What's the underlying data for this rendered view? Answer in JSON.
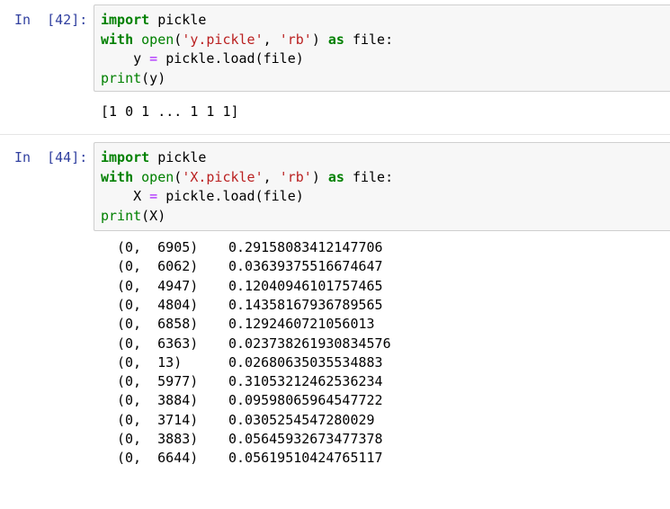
{
  "cells": [
    {
      "prompt": "In  [42]:",
      "code": {
        "line1": {
          "kw": "import",
          "rest": " pickle"
        },
        "line2": {
          "kw": "with",
          "sp1": " ",
          "fn": "open",
          "p1": "(",
          "s1": "'y.pickle'",
          "c": ", ",
          "s2": "'rb'",
          "p2": ") ",
          "kw2": "as",
          "rest": " file:"
        },
        "line3": {
          "indent": "    ",
          "var": "y",
          "eq": " = ",
          "rest": "pickle.load(file)"
        },
        "line4": {
          "fn": "print",
          "rest": "(y)"
        }
      },
      "output": "[1 0 1 ... 1 1 1]"
    },
    {
      "prompt": "In  [44]:",
      "code": {
        "line1": {
          "kw": "import",
          "rest": " pickle"
        },
        "line2": {
          "kw": "with",
          "sp1": " ",
          "fn": "open",
          "p1": "(",
          "s1": "'X.pickle'",
          "c": ", ",
          "s2": "'rb'",
          "p2": ") ",
          "kw2": "as",
          "rest": " file:"
        },
        "line3": {
          "indent": "    ",
          "var": "X",
          "eq": " = ",
          "rest": "pickle.load(file)"
        },
        "line4": {
          "fn": "print",
          "rest": "(X)"
        }
      },
      "output_rows": [
        {
          "idx": "(0,  6905)",
          "val": "0.29158083412147706"
        },
        {
          "idx": "(0,  6062)",
          "val": "0.03639375516674647"
        },
        {
          "idx": "(0,  4947)",
          "val": "0.12040946101757465"
        },
        {
          "idx": "(0,  4804)",
          "val": "0.14358167936789565"
        },
        {
          "idx": "(0,  6858)",
          "val": "0.1292460721056013"
        },
        {
          "idx": "(0,  6363)",
          "val": "0.023738261930834576"
        },
        {
          "idx": "(0,  13)",
          "val": "0.02680635035534883"
        },
        {
          "idx": "(0,  5977)",
          "val": "0.31053212462536234"
        },
        {
          "idx": "(0,  3884)",
          "val": "0.09598065964547722"
        },
        {
          "idx": "(0,  3714)",
          "val": "0.0305254547280029"
        },
        {
          "idx": "(0,  3883)",
          "val": "0.05645932673477378"
        },
        {
          "idx": "(0,  6644)",
          "val": "0.05619510424765117"
        }
      ]
    }
  ],
  "colors": {
    "prompt": "#303f9f",
    "keyword": "#008000",
    "string": "#ba2121",
    "operator": "#aa22ff",
    "input_background": "#f7f7f7",
    "input_border": "#cfcfcf"
  }
}
